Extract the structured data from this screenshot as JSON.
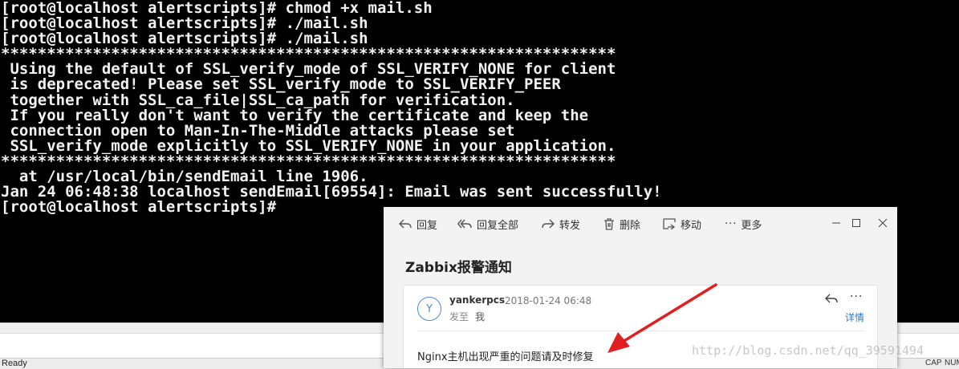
{
  "terminal": {
    "lines": [
      "[root@localhost alertscripts]# chmod +x mail.sh",
      "[root@localhost alertscripts]# ./mail.sh",
      "[root@localhost alertscripts]# ./mail.sh",
      "*******************************************************************",
      " Using the default of SSL_verify_mode of SSL_VERIFY_NONE for client",
      " is deprecated! Please set SSL_verify_mode to SSL_VERIFY_PEER",
      " together with SSL_ca_file|SSL_ca_path for verification.",
      " If you really don't want to verify the certificate and keep the",
      " connection open to Man-In-The-Middle attacks please set",
      " SSL_verify_mode explicitly to SSL_VERIFY_NONE in your application.",
      "*******************************************************************",
      "  at /usr/local/bin/sendEmail line 1906.",
      "Jan 24 06:48:38 localhost sendEmail[69554]: Email was sent successfully!",
      "[root@localhost alertscripts]# "
    ]
  },
  "statusbar": {
    "left": "Ready",
    "cap": "CAP",
    "num": "NUM"
  },
  "mail": {
    "toolbar": {
      "reply": "回复",
      "reply_all": "回复全部",
      "forward": "转发",
      "delete": "删除",
      "move": "移动",
      "more": "更多"
    },
    "subject": "Zabbix报警通知",
    "avatar_letter": "Y",
    "sender": "yankerpcs",
    "date": "2018-01-24 06:48",
    "to_label": "发至",
    "to_value": "我",
    "details": "详情",
    "body": "Nginx主机出现严重的问题请及时修复"
  },
  "watermark": "http://blog.csdn.net/qq_39591494",
  "colors": {
    "terminal_bg": "#000000",
    "terminal_fg": "#f2f2f2",
    "link": "#2b78d2",
    "arrow": "#e02020"
  }
}
